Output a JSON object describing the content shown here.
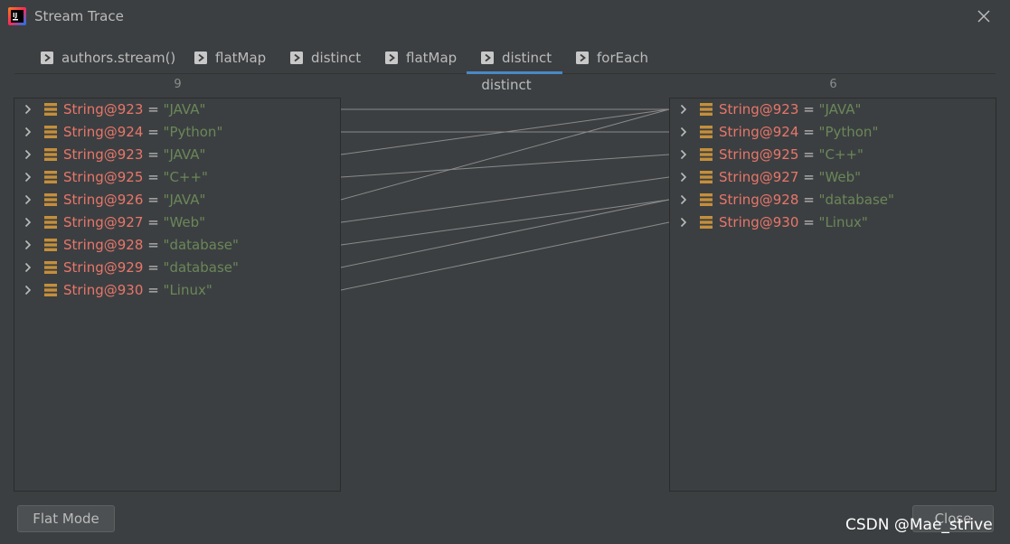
{
  "window": {
    "title": "Stream Trace",
    "app_icon": "intellij-idea-icon",
    "close_icon": "close-icon"
  },
  "tabs": [
    {
      "label": "authors.stream()",
      "icon": "play-arrow-icon",
      "active": false
    },
    {
      "label": "flatMap",
      "icon": "play-arrow-icon",
      "active": false
    },
    {
      "label": "distinct",
      "icon": "play-arrow-icon",
      "active": false
    },
    {
      "label": "flatMap",
      "icon": "play-arrow-icon",
      "active": false
    },
    {
      "label": "distinct",
      "icon": "play-arrow-icon",
      "active": true
    },
    {
      "label": "forEach",
      "icon": "play-arrow-icon",
      "active": false
    }
  ],
  "left_panel": {
    "count": "9",
    "items": [
      {
        "name": "String@923",
        "eq": "=",
        "value": "\"JAVA\""
      },
      {
        "name": "String@924",
        "eq": "=",
        "value": "\"Python\""
      },
      {
        "name": "String@923",
        "eq": "=",
        "value": "\"JAVA\""
      },
      {
        "name": "String@925",
        "eq": "=",
        "value": "\"C++\""
      },
      {
        "name": "String@926",
        "eq": "=",
        "value": "\"JAVA\""
      },
      {
        "name": "String@927",
        "eq": "=",
        "value": "\"Web\""
      },
      {
        "name": "String@928",
        "eq": "=",
        "value": "\"database\""
      },
      {
        "name": "String@929",
        "eq": "=",
        "value": "\"database\""
      },
      {
        "name": "String@930",
        "eq": "=",
        "value": "\"Linux\""
      }
    ]
  },
  "center": {
    "operation": "distinct"
  },
  "right_panel": {
    "count": "6",
    "items": [
      {
        "name": "String@923",
        "eq": "=",
        "value": "\"JAVA\""
      },
      {
        "name": "String@924",
        "eq": "=",
        "value": "\"Python\""
      },
      {
        "name": "String@925",
        "eq": "=",
        "value": "\"C++\""
      },
      {
        "name": "String@927",
        "eq": "=",
        "value": "\"Web\""
      },
      {
        "name": "String@928",
        "eq": "=",
        "value": "\"database\""
      },
      {
        "name": "String@930",
        "eq": "=",
        "value": "\"Linux\""
      }
    ]
  },
  "mappings": [
    [
      0,
      0
    ],
    [
      1,
      1
    ],
    [
      2,
      0
    ],
    [
      3,
      2
    ],
    [
      4,
      0
    ],
    [
      5,
      3
    ],
    [
      6,
      4
    ],
    [
      7,
      4
    ],
    [
      8,
      5
    ]
  ],
  "buttons": {
    "flat_mode": "Flat Mode",
    "close": "Close"
  },
  "watermark": "CSDN @Mae_strive",
  "colors": {
    "background": "#3c3f41",
    "accent_tab_underline": "#4a88c7",
    "variable_name": "#e8766a",
    "string_value": "#6a8759",
    "object_icon": "#c48f3c",
    "link_line": "#8a8a8a"
  }
}
